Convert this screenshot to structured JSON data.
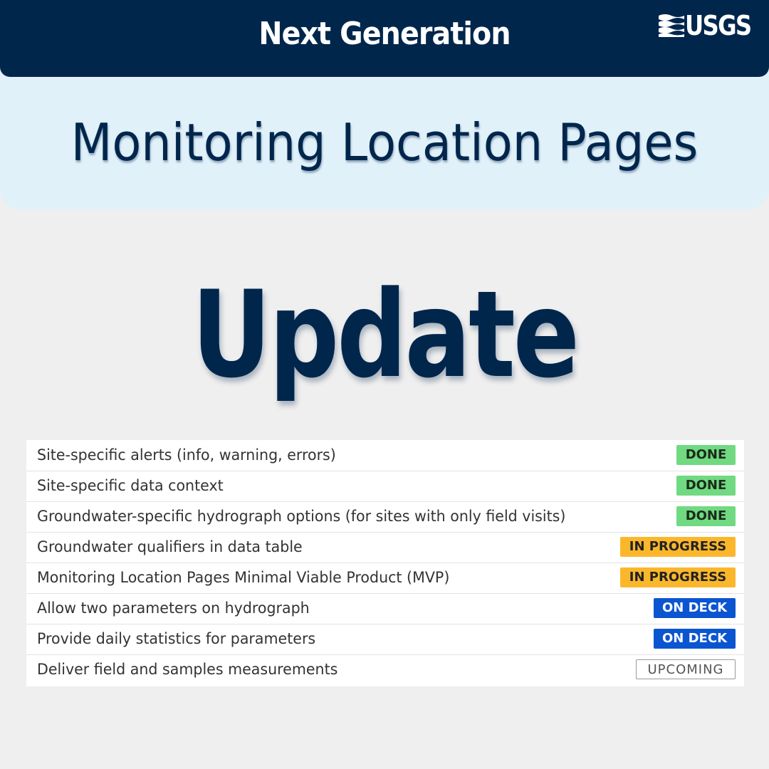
{
  "header": {
    "title": "Next Generation",
    "logo_text": "USGS"
  },
  "subtitle": "Monitoring Location Pages",
  "heading": "Update",
  "roadmap": {
    "items": [
      {
        "label": "Site-specific alerts (info, warning, errors)",
        "status": "DONE"
      },
      {
        "label": "Site-specific data context",
        "status": "DONE"
      },
      {
        "label": "Groundwater-specific hydrograph options (for sites with only field visits)",
        "status": "DONE"
      },
      {
        "label": "Groundwater qualifiers in data table",
        "status": "IN PROGRESS"
      },
      {
        "label": "Monitoring Location Pages Minimal Viable Product (MVP)",
        "status": "IN PROGRESS"
      },
      {
        "label": "Allow two parameters on hydrograph",
        "status": "ON DECK"
      },
      {
        "label": "Provide daily statistics for parameters",
        "status": "ON DECK"
      },
      {
        "label": "Deliver field and samples measurements",
        "status": "UPCOMING"
      }
    ]
  },
  "colors": {
    "navy": "#00264c",
    "light_blue_band": "#e1f1fa",
    "background": "#efefef",
    "done": "#70d981",
    "in_progress": "#fbb72c",
    "on_deck": "#0b55d1",
    "upcoming_border": "#9a9a9a"
  },
  "icons": {
    "logo": "usgs-waves-icon"
  }
}
